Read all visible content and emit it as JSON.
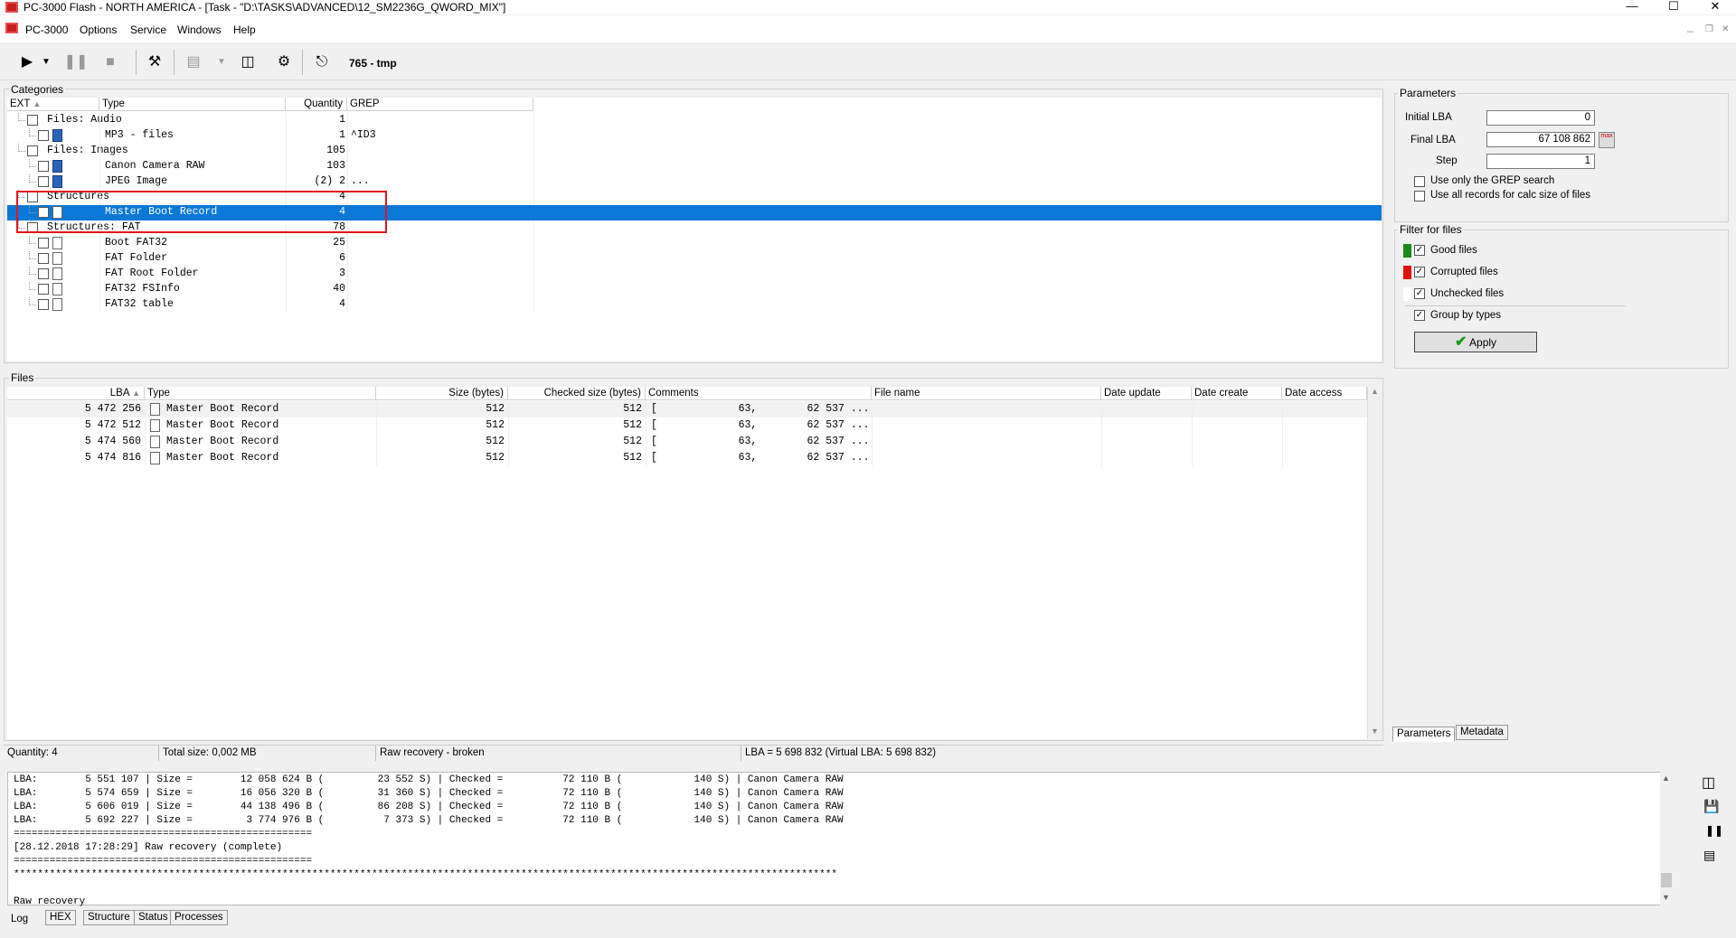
{
  "window": {
    "title": "PC-3000 Flash - NORTH AMERICA - [Task - \"D:\\TASKS\\ADVANCED\\12_SM2236G_QWORD_MIX\"]",
    "min": "—",
    "max": "☐",
    "close": "✕"
  },
  "menu": {
    "items": [
      "PC-3000",
      "Options",
      "Service",
      "Windows",
      "Help"
    ],
    "mdi_min": "–",
    "mdi_restore": "❐",
    "mdi_close": "✕"
  },
  "toolbar": {
    "task_label": "765 - tmp",
    "icons": [
      "play-icon",
      "dropdown-icon",
      "pause-icon",
      "stop-icon",
      "tools-icon",
      "import-icon",
      "dropdown-icon",
      "export-icon",
      "settings-icon",
      "exit-icon"
    ]
  },
  "categories": {
    "title": "Categories",
    "headers": {
      "ext": "EXT",
      "type": "Type",
      "quantity": "Quantity",
      "grep": "GREP"
    },
    "rows": [
      {
        "label": "Files: Audio",
        "qty": "1",
        "grep": "",
        "level": 0,
        "icon": ""
      },
      {
        "label": "MP3 - files",
        "qty": "1",
        "grep": "^ID3",
        "level": 1,
        "icon": "audio"
      },
      {
        "label": "Files: Images",
        "qty": "105",
        "grep": "",
        "level": 0,
        "icon": ""
      },
      {
        "label": "Canon Camera RAW",
        "qty": "103",
        "grep": "",
        "level": 1,
        "icon": "image"
      },
      {
        "label": "JPEG Image",
        "qty": "(2) 2",
        "grep": "...",
        "level": 1,
        "icon": "image"
      },
      {
        "label": "Structures",
        "qty": "4",
        "grep": "",
        "level": 0,
        "icon": ""
      },
      {
        "label": "Master Boot Record",
        "qty": "4",
        "grep": "",
        "level": 1,
        "icon": "file",
        "selected": true
      },
      {
        "label": "Structures: FAT",
        "qty": "78",
        "grep": "",
        "level": 0,
        "icon": ""
      },
      {
        "label": "Boot FAT32",
        "qty": "25",
        "grep": "",
        "level": 1,
        "icon": "file"
      },
      {
        "label": "FAT Folder",
        "qty": "6",
        "grep": "",
        "level": 1,
        "icon": "file"
      },
      {
        "label": "FAT Root Folder",
        "qty": "3",
        "grep": "",
        "level": 1,
        "icon": "file"
      },
      {
        "label": "FAT32 FSInfo",
        "qty": "40",
        "grep": "",
        "level": 1,
        "icon": "file"
      },
      {
        "label": "FAT32 table",
        "qty": "4",
        "grep": "",
        "level": 1,
        "icon": "file"
      }
    ]
  },
  "files": {
    "title": "Files",
    "headers": {
      "lba": "LBA",
      "type": "Type",
      "size": "Size (bytes)",
      "checked": "Checked size (bytes)",
      "comments": "Comments",
      "filename": "File name",
      "date_update": "Date update",
      "date_create": "Date create",
      "date_access": "Date access"
    },
    "rows": [
      {
        "lba": "5 472 256",
        "type": "Master Boot Record",
        "size": "512",
        "checked": "512",
        "comments": "[             63,        62 537 ..."
      },
      {
        "lba": "5 472 512",
        "type": "Master Boot Record",
        "size": "512",
        "checked": "512",
        "comments": "[             63,        62 537 ..."
      },
      {
        "lba": "5 474 560",
        "type": "Master Boot Record",
        "size": "512",
        "checked": "512",
        "comments": "[             63,        62 537 ..."
      },
      {
        "lba": "5 474 816",
        "type": "Master Boot Record",
        "size": "512",
        "checked": "512",
        "comments": "[             63,        62 537 ..."
      }
    ]
  },
  "status": {
    "quantity": "Quantity: 4",
    "total_size": "Total size: 0,002 MB",
    "mode": "Raw recovery - broken",
    "lba": "LBA = 5 698 832 (Virtual LBA: 5 698 832)"
  },
  "params": {
    "title": "Parameters",
    "initial_lba_label": "Initial LBA",
    "initial_lba": "0",
    "final_lba_label": "Final  LBA",
    "final_lba": "67 108 862",
    "max_label": "max",
    "step_label": "Step",
    "step": "1",
    "grep_only": "Use only the GREP search",
    "all_records": "Use all records for calc size of files"
  },
  "filter": {
    "title": "Filter for files",
    "items": [
      {
        "label": "Good files",
        "color": "#1a8a1a",
        "checked": true
      },
      {
        "label": "Corrupted files",
        "color": "#e01010",
        "checked": true
      },
      {
        "label": "Unchecked files",
        "color": "#ffffff",
        "checked": true
      }
    ],
    "group_by_types": "Group by types",
    "apply": "Apply"
  },
  "right_tabs": [
    "Parameters",
    "Metadata"
  ],
  "log": {
    "lines": [
      "LBA:        5 551 107 | Size =        12 058 624 B (         23 552 S) | Checked =          72 110 B (            140 S) | Canon Camera RAW",
      "LBA:        5 574 659 | Size =        16 056 320 B (         31 360 S) | Checked =          72 110 B (            140 S) | Canon Camera RAW",
      "LBA:        5 606 019 | Size =        44 138 496 B (         86 208 S) | Checked =          72 110 B (            140 S) | Canon Camera RAW",
      "LBA:        5 692 227 | Size =         3 774 976 B (          7 373 S) | Checked =          72 110 B (            140 S) | Canon Camera RAW",
      "==================================================",
      "[28.12.2018 17:28:29] Raw recovery (complete)",
      "==================================================",
      "******************************************************************************************************************************************",
      "",
      "Raw recovery"
    ],
    "tabs": [
      "Log",
      "HEX",
      "Structure",
      "Status",
      "Processes"
    ]
  }
}
